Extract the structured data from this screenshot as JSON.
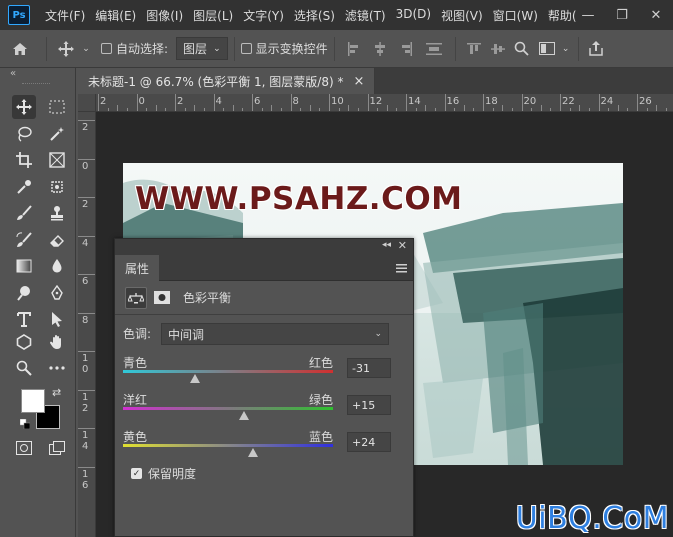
{
  "app": {
    "logo": "Ps"
  },
  "menu": {
    "items": [
      "文件(F)",
      "编辑(E)",
      "图像(I)",
      "图层(L)",
      "文字(Y)",
      "选择(S)",
      "滤镜(T)",
      "3D(D)",
      "视图(V)",
      "窗口(W)",
      "帮助("
    ]
  },
  "window_controls": {
    "minimize": "—",
    "restore": "❐",
    "close": "✕"
  },
  "options_bar": {
    "auto_select_label": "自动选择:",
    "auto_select_target": "图层",
    "show_transform_label": "显示变换控件"
  },
  "panel_collapse": "«",
  "document": {
    "tab_title": "未标题-1 @ 66.7% (色彩平衡 1, 图层蒙版/8) *",
    "close": "×",
    "ruler_top": [
      "2",
      "0",
      "2",
      "4",
      "6",
      "8",
      "10",
      "12",
      "14",
      "16",
      "18",
      "20",
      "22",
      "24",
      "26"
    ],
    "ruler_left": [
      "2",
      "0",
      "2",
      "4",
      "6",
      "8",
      "1\n0",
      "1\n2",
      "1\n4",
      "1\n6"
    ]
  },
  "canvas": {
    "watermark": "WWW.PSAHZ.COM"
  },
  "properties_panel": {
    "tab": "属性",
    "adjustment_name": "色彩平衡",
    "tone_label": "色调:",
    "tone_value": "中间调",
    "sliders": [
      {
        "left": "青色",
        "right": "红色",
        "value": "-31",
        "level": -31
      },
      {
        "left": "洋红",
        "right": "绿色",
        "value": "+15",
        "level": 15
      },
      {
        "left": "黄色",
        "right": "蓝色",
        "value": "+24",
        "level": 24
      }
    ],
    "preserve_luminosity_label": "保留明度",
    "preserve_luminosity_checked": true
  },
  "site_logo": "UiBQ.CoM",
  "colors": {
    "menubar": "#323232",
    "panel": "#535353",
    "accent": "#31a8ff"
  }
}
